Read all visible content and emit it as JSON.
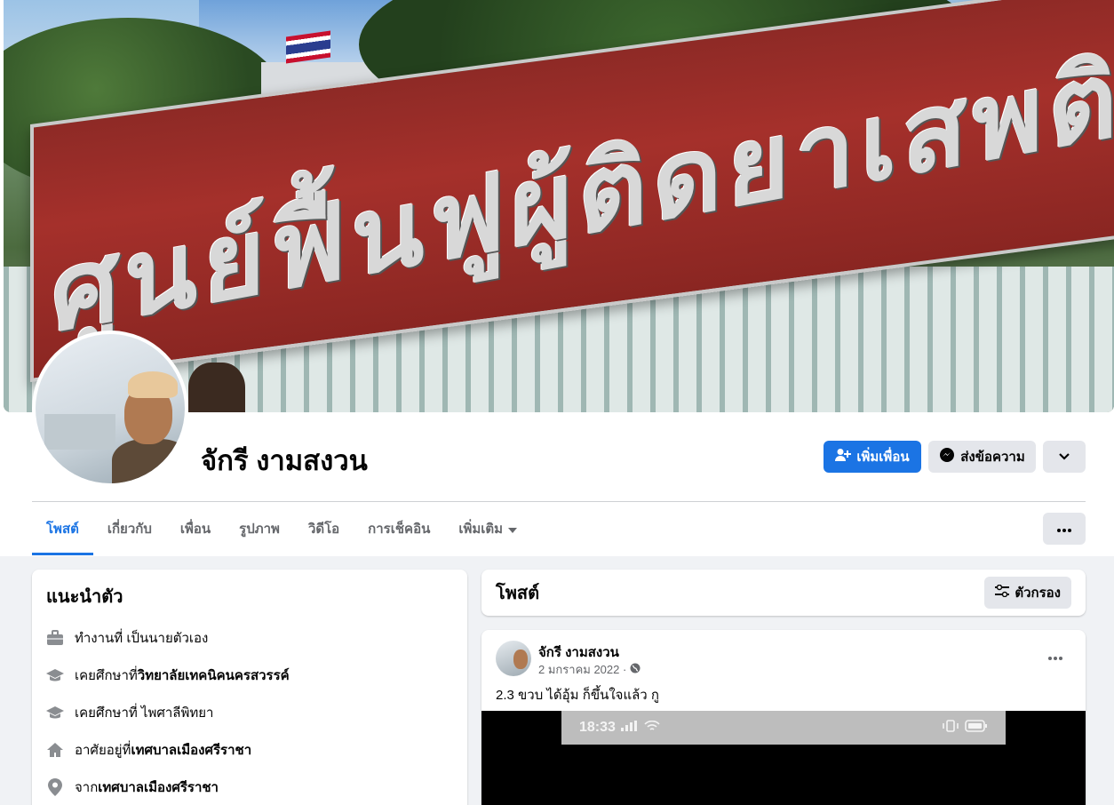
{
  "profile": {
    "name": "จักรี งามสงวน",
    "cover_sign_text": "ศูนย์ฟื้นฟูผู้ติดยาเสพติด"
  },
  "actions": {
    "add_friend": "เพิ่มเพื่อน",
    "message": "ส่งข้อความ"
  },
  "tabs": [
    {
      "label": "โพสต์",
      "active": true
    },
    {
      "label": "เกี่ยวกับ"
    },
    {
      "label": "เพื่อน"
    },
    {
      "label": "รูปภาพ"
    },
    {
      "label": "วิดีโอ"
    },
    {
      "label": "การเช็คอิน"
    },
    {
      "label": "เพิ่มเติม"
    }
  ],
  "intro": {
    "title": "แนะนำตัว",
    "items": [
      {
        "icon": "briefcase-icon",
        "prefix": "ทำงานที่ เป็นนายตัวเอง",
        "value": ""
      },
      {
        "icon": "graduation-cap-icon",
        "prefix": "เคยศึกษาที่ ",
        "value": "วิทยาลัยเทคนิคนครสวรรค์"
      },
      {
        "icon": "graduation-cap-icon",
        "prefix": "เคยศึกษาที่ ไพศาลีพิทยา",
        "value": ""
      },
      {
        "icon": "home-icon",
        "prefix": "อาศัยอยู่ที่ ",
        "value": "เทศบาลเมืองศรีราชา"
      },
      {
        "icon": "location-pin-icon",
        "prefix": "จาก ",
        "value": "เทศบาลเมืองศรีราชา"
      }
    ]
  },
  "posts_header": {
    "title": "โพสต์",
    "filter": "ตัวกรอง"
  },
  "post": {
    "author": "จักรี งามสงวน",
    "date": "2 มกราคม 2022 ·",
    "text": "2.3 ขวบ ได้อุ้ม ก็ขึ้นใจแล้ว กู",
    "media_time": "18:33"
  },
  "colors": {
    "accent": "#1b74e4",
    "background": "#f0f2f5",
    "button_gray": "#e4e6eb",
    "muted_text": "#65676b"
  }
}
